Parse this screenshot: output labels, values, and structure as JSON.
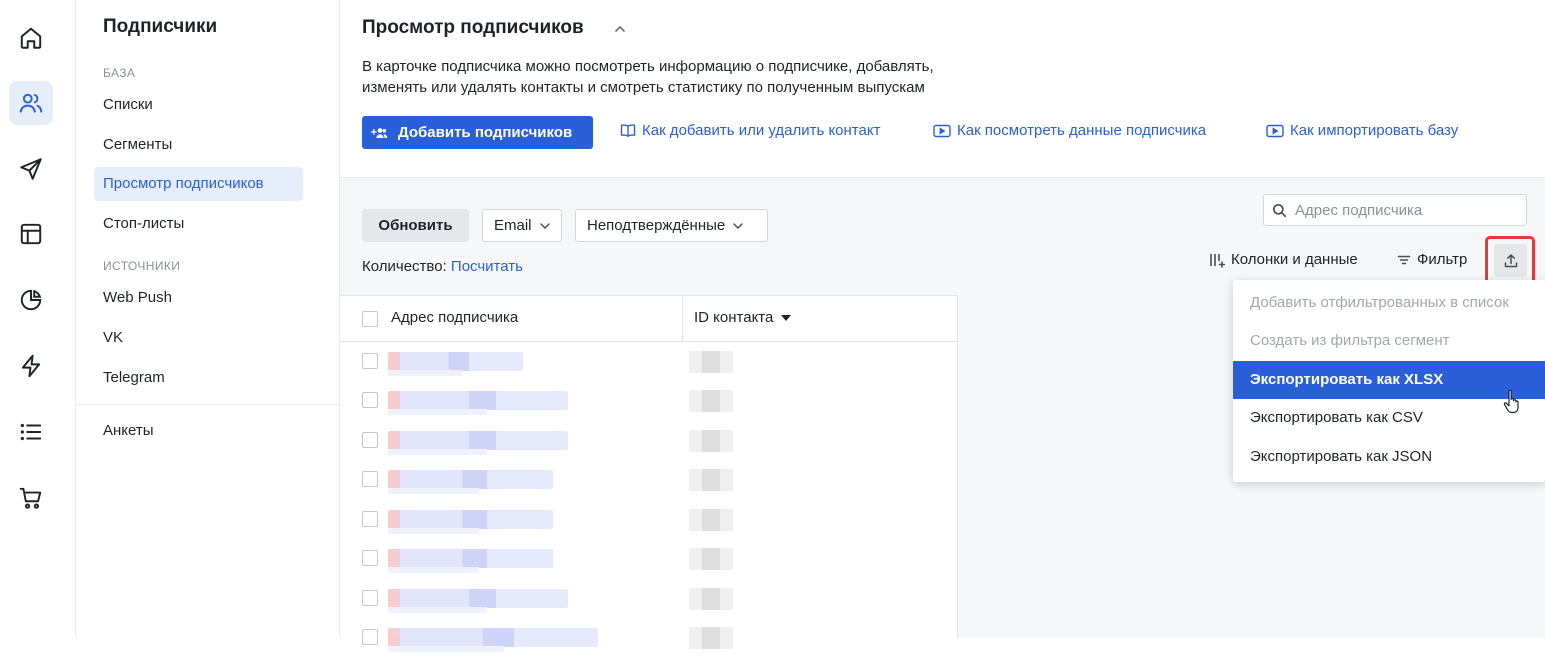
{
  "colors": {
    "accent": "#2b5fd9",
    "highlight": "#e5393b"
  },
  "rail": {
    "items": [
      {
        "icon": "home-icon"
      },
      {
        "icon": "users-icon",
        "active": true
      },
      {
        "icon": "send-icon"
      },
      {
        "icon": "layout-icon"
      },
      {
        "icon": "pie-chart-icon"
      },
      {
        "icon": "lightning-icon"
      },
      {
        "icon": "list-icon"
      },
      {
        "icon": "cart-icon"
      }
    ]
  },
  "sidebar": {
    "title": "Подписчики",
    "group_base": "БАЗА",
    "lists": "Списки",
    "segments": "Сегменты",
    "view": "Просмотр подписчиков",
    "stoplists": "Стоп-листы",
    "group_sources": "ИСТОЧНИКИ",
    "webpush": "Web Push",
    "vk": "VK",
    "telegram": "Telegram",
    "forms": "Анкеты"
  },
  "header": {
    "title": "Просмотр подписчиков",
    "desc_line1": "В карточке подписчика можно посмотреть информацию о подписчике, добавлять,",
    "desc_line2": "изменять или удалять контакты и смотреть статистику по полученным выпускам",
    "add_button": "Добавить подписчиков",
    "links": [
      {
        "label": "Как добавить или удалить контакт",
        "icon": "book-icon"
      },
      {
        "label": "Как посмотреть данные подписчика",
        "icon": "video-icon"
      },
      {
        "label": "Как импортировать базу",
        "icon": "video-icon"
      }
    ]
  },
  "toolbar": {
    "refresh": "Обновить",
    "channel_select": "Email",
    "status_select": "Неподтверждённые",
    "count_label": "Количество:",
    "count_link": "Посчитать",
    "search_placeholder": "Адрес подписчика",
    "columns": "Колонки и данные",
    "filter": "Фильтр"
  },
  "table": {
    "columns": [
      "Адрес подписчика",
      "ID контакта"
    ]
  },
  "export_menu": {
    "items": [
      {
        "label": "Добавить отфильтрованных в список",
        "state": "disabled"
      },
      {
        "label": "Создать из фильтра сегмент",
        "state": "disabled"
      },
      {
        "label": "Экспортировать как XLSX",
        "state": "active"
      },
      {
        "label": "Экспортировать как CSV",
        "state": "normal"
      },
      {
        "label": "Экспортировать как JSON",
        "state": "normal"
      }
    ]
  }
}
